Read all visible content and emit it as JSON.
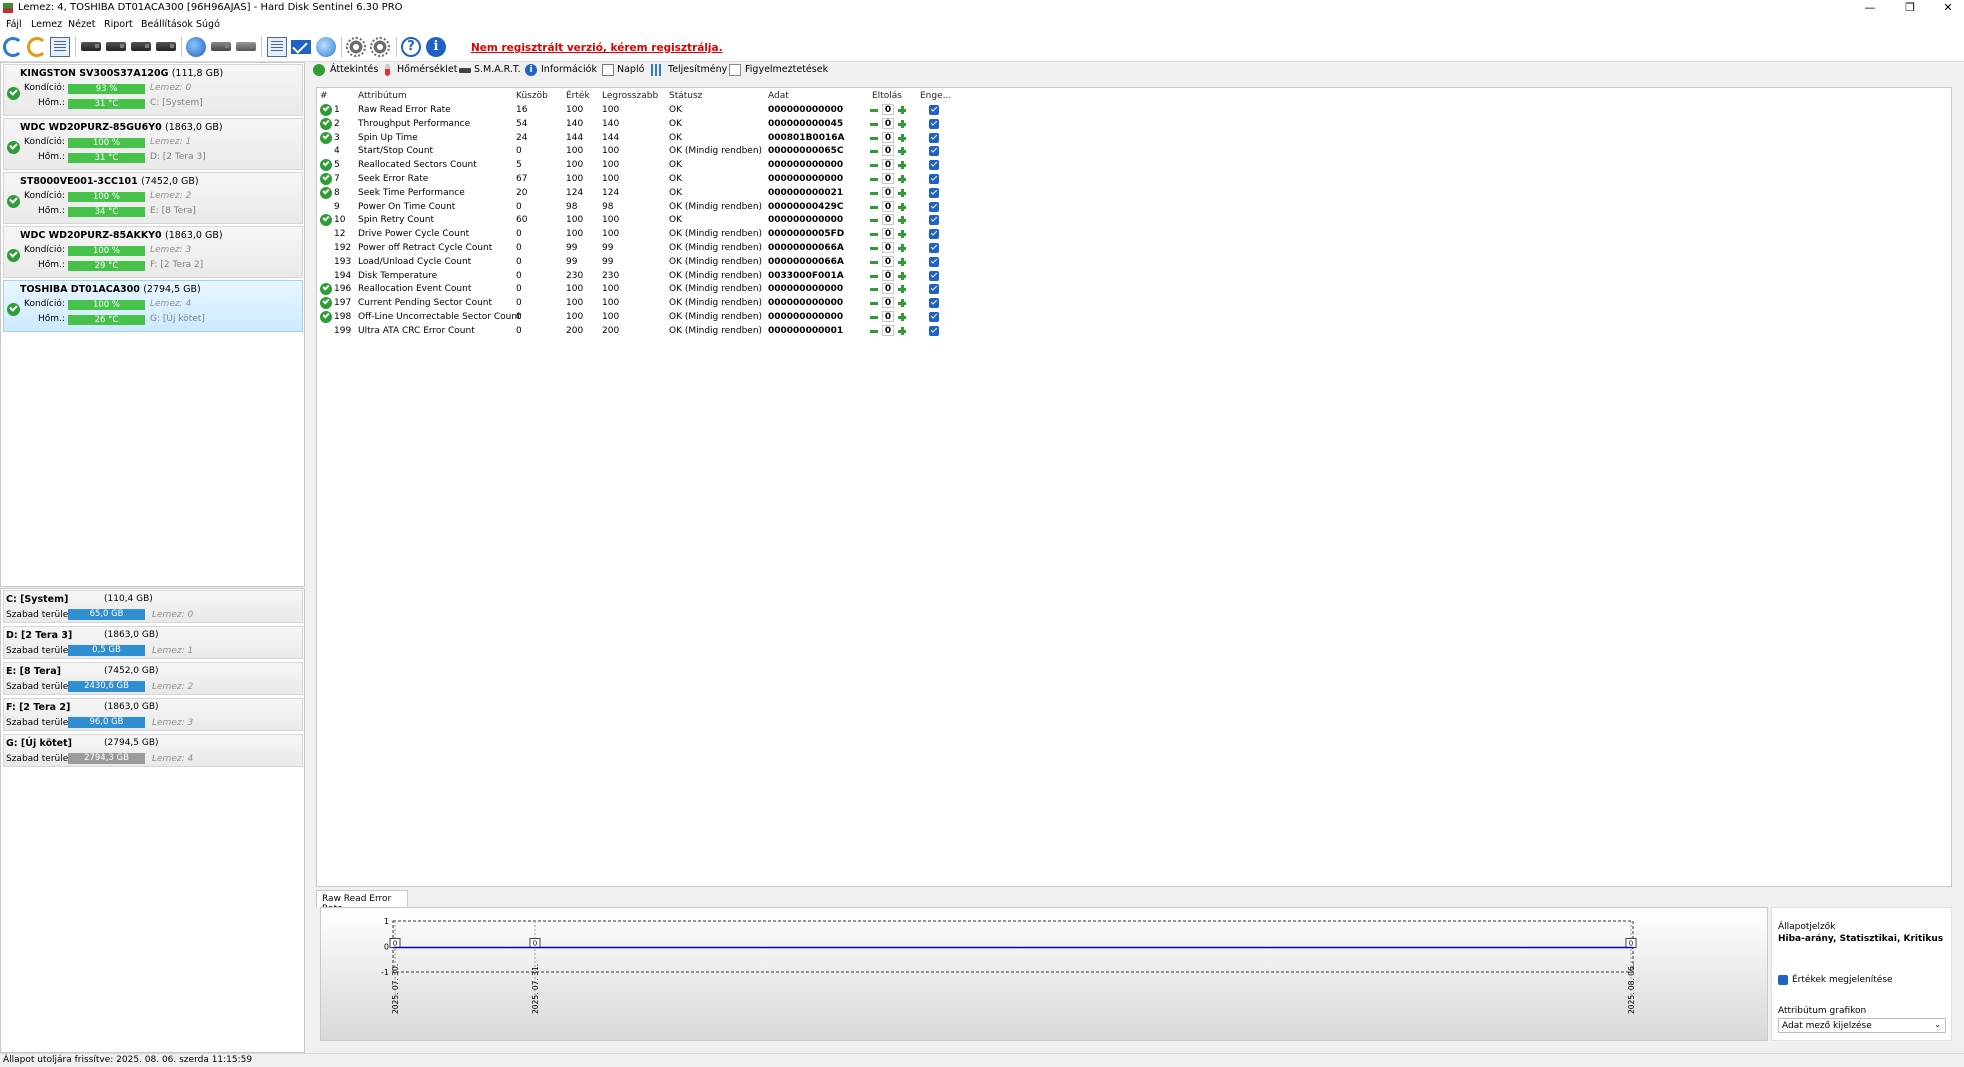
{
  "window": {
    "title": "Lemez: 4, TOSHIBA DT01ACA300 [96H96AJAS]  -  Hard Disk Sentinel 6.30 PRO",
    "minimize": "—",
    "maximize": "❐",
    "close": "✕"
  },
  "menu": [
    "Fájl",
    "Lemez",
    "Nézet",
    "Riport",
    "Beállítások",
    "Súgó"
  ],
  "toolbar": {
    "registration_warning": "Nem regisztrált verzió, kérem regisztrálja.",
    "help_glyph": "?",
    "info_glyph": "i",
    "icons": [
      "refresh-icon",
      "refresh-all-icon",
      "list-icon",
      "disk-icon",
      "disk-icon",
      "disk-ok-icon",
      "disk-icon",
      "globe-icon",
      "printer-icon",
      "save-icon",
      "report-icon",
      "mail-icon",
      "network-icon",
      "settings-icon",
      "settings-advanced-icon",
      "help-icon",
      "info-icon"
    ]
  },
  "disks": [
    {
      "name": "KINGSTON SV300S37A120G",
      "size": "(111,8 GB)",
      "cond_label": "Kondíció:",
      "cond": "93 %",
      "disk_no": "Lemez: 0",
      "temp_label": "Hőm.:",
      "temp": "31 °C",
      "vol": "C: [System]",
      "selected": false
    },
    {
      "name": "WDC WD20PURZ-85GU6Y0",
      "size": "(1863,0 GB)",
      "cond_label": "Kondíció:",
      "cond": "100 %",
      "disk_no": "Lemez: 1",
      "temp_label": "Hőm.:",
      "temp": "31 °C",
      "vol": "D: [2 Tera 3]",
      "selected": false
    },
    {
      "name": "ST8000VE001-3CC101",
      "size": "(7452,0 GB)",
      "cond_label": "Kondíció:",
      "cond": "100 %",
      "disk_no": "Lemez: 2",
      "temp_label": "Hőm.:",
      "temp": "34 °C",
      "vol": "E: [8 Tera]",
      "selected": false
    },
    {
      "name": "WDC WD20PURZ-85AKKY0",
      "size": "(1863,0 GB)",
      "cond_label": "Kondíció:",
      "cond": "100 %",
      "disk_no": "Lemez: 3",
      "temp_label": "Hőm.:",
      "temp": "29 °C",
      "vol": "F: [2 Tera 2]",
      "selected": false
    },
    {
      "name": "TOSHIBA DT01ACA300",
      "size": "(2794,5 GB)",
      "cond_label": "Kondíció:",
      "cond": "100 %",
      "disk_no": "Lemez: 4",
      "temp_label": "Hőm.:",
      "temp": "26 °C",
      "vol": "G: [Új kötet]",
      "selected": true
    }
  ],
  "volumes": [
    {
      "name": "C: [System]",
      "size": "(110,4 GB)",
      "free_label": "Szabad terület",
      "free": "65,0 GB",
      "disk": "Lemez: 0",
      "grey": false
    },
    {
      "name": "D: [2 Tera 3]",
      "size": "(1863,0 GB)",
      "free_label": "Szabad terület",
      "free": "0,5 GB",
      "disk": "Lemez: 1",
      "grey": false
    },
    {
      "name": "E: [8 Tera]",
      "size": "(7452,0 GB)",
      "free_label": "Szabad terület",
      "free": "2430,6 GB",
      "disk": "Lemez: 2",
      "grey": false
    },
    {
      "name": "F: [2 Tera 2]",
      "size": "(1863,0 GB)",
      "free_label": "Szabad terület",
      "free": "96,0 GB",
      "disk": "Lemez: 3",
      "grey": false
    },
    {
      "name": "G: [Új kötet]",
      "size": "(2794,5 GB)",
      "free_label": "Szabad terület",
      "free": "2794,3 GB",
      "disk": "Lemez: 4",
      "grey": true
    }
  ],
  "tabs": [
    "Áttekintés",
    "Hőmérséklet",
    "S.M.A.R.T.",
    "Információk",
    "Napló",
    "Teljesítmény",
    "Figyelmeztetések"
  ],
  "smart": {
    "headers": [
      "#",
      "Attribútum",
      "Küszöb",
      "Érték",
      "Legrosszabb",
      "Státusz",
      "Adat",
      "Eltolás",
      "Enge..."
    ],
    "rows": [
      {
        "id": "1",
        "attr": "Raw Read Error Rate",
        "thr": "16",
        "val": "100",
        "worst": "100",
        "status": "OK",
        "data": "000000000000",
        "offset": "0",
        "ok_icon": true
      },
      {
        "id": "2",
        "attr": "Throughput Performance",
        "thr": "54",
        "val": "140",
        "worst": "140",
        "status": "OK",
        "data": "000000000045",
        "offset": "0",
        "ok_icon": true
      },
      {
        "id": "3",
        "attr": "Spin Up Time",
        "thr": "24",
        "val": "144",
        "worst": "144",
        "status": "OK",
        "data": "000801B0016A",
        "offset": "0",
        "ok_icon": true
      },
      {
        "id": "4",
        "attr": "Start/Stop Count",
        "thr": "0",
        "val": "100",
        "worst": "100",
        "status": "OK (Mindig rendben)",
        "data": "00000000065C",
        "offset": "0",
        "ok_icon": false
      },
      {
        "id": "5",
        "attr": "Reallocated Sectors Count",
        "thr": "5",
        "val": "100",
        "worst": "100",
        "status": "OK",
        "data": "000000000000",
        "offset": "0",
        "ok_icon": true
      },
      {
        "id": "7",
        "attr": "Seek Error Rate",
        "thr": "67",
        "val": "100",
        "worst": "100",
        "status": "OK",
        "data": "000000000000",
        "offset": "0",
        "ok_icon": true
      },
      {
        "id": "8",
        "attr": "Seek Time Performance",
        "thr": "20",
        "val": "124",
        "worst": "124",
        "status": "OK",
        "data": "000000000021",
        "offset": "0",
        "ok_icon": true
      },
      {
        "id": "9",
        "attr": "Power On Time Count",
        "thr": "0",
        "val": "98",
        "worst": "98",
        "status": "OK (Mindig rendben)",
        "data": "00000000429C",
        "offset": "0",
        "ok_icon": false
      },
      {
        "id": "10",
        "attr": "Spin Retry Count",
        "thr": "60",
        "val": "100",
        "worst": "100",
        "status": "OK",
        "data": "000000000000",
        "offset": "0",
        "ok_icon": true
      },
      {
        "id": "12",
        "attr": "Drive Power Cycle Count",
        "thr": "0",
        "val": "100",
        "worst": "100",
        "status": "OK (Mindig rendben)",
        "data": "0000000005FD",
        "offset": "0",
        "ok_icon": false
      },
      {
        "id": "192",
        "attr": "Power off Retract Cycle Count",
        "thr": "0",
        "val": "99",
        "worst": "99",
        "status": "OK (Mindig rendben)",
        "data": "00000000066A",
        "offset": "0",
        "ok_icon": false
      },
      {
        "id": "193",
        "attr": "Load/Unload Cycle Count",
        "thr": "0",
        "val": "99",
        "worst": "99",
        "status": "OK (Mindig rendben)",
        "data": "00000000066A",
        "offset": "0",
        "ok_icon": false
      },
      {
        "id": "194",
        "attr": "Disk Temperature",
        "thr": "0",
        "val": "230",
        "worst": "230",
        "status": "OK (Mindig rendben)",
        "data": "0033000F001A",
        "offset": "0",
        "ok_icon": false
      },
      {
        "id": "196",
        "attr": "Reallocation Event Count",
        "thr": "0",
        "val": "100",
        "worst": "100",
        "status": "OK (Mindig rendben)",
        "data": "000000000000",
        "offset": "0",
        "ok_icon": true
      },
      {
        "id": "197",
        "attr": "Current Pending Sector Count",
        "thr": "0",
        "val": "100",
        "worst": "100",
        "status": "OK (Mindig rendben)",
        "data": "000000000000",
        "offset": "0",
        "ok_icon": true
      },
      {
        "id": "198",
        "attr": "Off-Line Uncorrectable Sector Count",
        "thr": "0",
        "val": "100",
        "worst": "100",
        "status": "OK (Mindig rendben)",
        "data": "000000000000",
        "offset": "0",
        "ok_icon": true
      },
      {
        "id": "199",
        "attr": "Ultra ATA CRC Error Count",
        "thr": "0",
        "val": "200",
        "worst": "200",
        "status": "OK (Mindig rendben)",
        "data": "000000000001",
        "offset": "0",
        "ok_icon": false
      }
    ]
  },
  "graph": {
    "tab": "Raw Read Error Rate",
    "y_ticks": [
      "1",
      "0",
      "-1"
    ],
    "x_dates": [
      "2025. 07. 30.",
      "2025. 07. 31.",
      "2025. 08. 06."
    ],
    "point_labels": [
      "0",
      "0",
      "0"
    ],
    "line_color": "#0000c8"
  },
  "side": {
    "title": "Állapotjelzők",
    "subtitle": "Hiba-arány, Statisztikai, Kritikus",
    "show_values": "Értékek megjelenítése",
    "attr_graph": "Attribútum grafikon",
    "select_value": "Adat mező kijelzése",
    "select_arrow": "⌄"
  },
  "status": "Állapot utoljára frissítve: 2025. 08. 06. szerda 11:15:59",
  "colors": {
    "ok_green": "#2e9d35",
    "warn_red": "#e00000",
    "vol_blue": "#2f8fd0",
    "selected_bg": "#cdeaff"
  }
}
